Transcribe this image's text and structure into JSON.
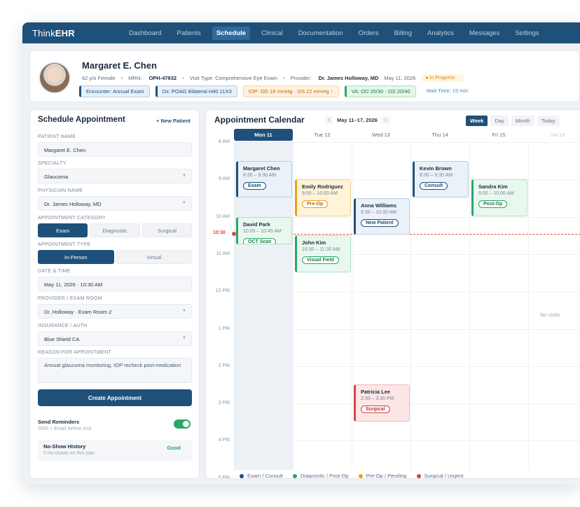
{
  "app": {
    "logo_prefix": "Think",
    "logo_suffix": "EHR",
    "nav": [
      "Dashboard",
      "Patients",
      "Schedule",
      "Clinical",
      "Documentation",
      "Orders",
      "Billing",
      "Analytics",
      "Messages",
      "Settings"
    ],
    "active_nav": "Schedule"
  },
  "patient": {
    "name": "Margaret E. Chen",
    "age_sex": "62 y/o Female",
    "mrn_label": "MRN:",
    "mrn": "OPH-47832",
    "visit_type": "Visit Type: Comprehensive Eye Exam",
    "provider_label": "Provider:",
    "provider": "Dr. James Holloway, MD",
    "date": "May 11, 2026",
    "status": "In Progress",
    "chips": {
      "encounter": "Encounter: Annual Exam",
      "dx": "Dx: POAG Bilateral H40.11X3",
      "iop": "IOP: OD 18 mmHg · OS 22 mmHg ↑",
      "va": "VA: OD 20/30 · OS 20/40",
      "wait": "Wait Time: 15 min"
    }
  },
  "form": {
    "title": "Schedule Appointment",
    "new_patient": "+ New Patient",
    "patient_name_label": "Patient Name",
    "patient_name": "Margaret E. Chen",
    "specialty_label": "Specialty",
    "specialty": "Glaucoma",
    "physician_label": "Physician Name",
    "physician": "Dr. James Holloway, MD",
    "category_label": "Appointment Category",
    "categories": [
      "Exam",
      "Diagnostic",
      "Surgical"
    ],
    "type_label": "Appointment Type",
    "types": [
      "In-Person",
      "Virtual"
    ],
    "datetime_label": "Date & Time",
    "datetime": "May 11, 2026 · 10:30 AM",
    "room_label": "Provider / Exam Room",
    "room": "Dr. Holloway · Exam Room 2",
    "insurance_label": "Insurance / Auth",
    "insurance": "Blue Shield CA",
    "reason_label": "Reason for Appointment",
    "reason": "Annual glaucoma monitoring, IOP recheck post-medication",
    "create_button": "Create Appointment",
    "reminders_label": "Send Reminders",
    "reminders_sub": "SMS + Email before visit",
    "reminders_on": true,
    "noshow_label": "No-Show History",
    "noshow_sub": "0 no-shows on this plan",
    "noshow_status": "Good"
  },
  "calendar": {
    "title": "Appointment Calendar",
    "range": "May 11–17, 2026",
    "views": [
      "Week",
      "Day",
      "Month",
      "Today"
    ],
    "days": [
      "Mon 11",
      "Tue 12",
      "Wed 13",
      "Thu 14",
      "Fri 15",
      "Sat 16"
    ],
    "hours": [
      "8 AM",
      "9 AM",
      "10 AM",
      "11 AM",
      "12 PM",
      "1 PM",
      "2 PM",
      "3 PM",
      "4 PM",
      "5 PM"
    ],
    "now_label": "10:30",
    "no_visits": "No visits",
    "appointments": [
      {
        "name": "Margaret Chen",
        "time": "8:30 – 9:30 AM",
        "tag": "Exam",
        "day": 0,
        "start": 8.5,
        "end": 9.5,
        "kind": "blue"
      },
      {
        "name": "David Park",
        "time": "10:00 – 10:45 AM",
        "tag": "OCT Scan",
        "day": 0,
        "start": 10.0,
        "end": 10.75,
        "kind": "green"
      },
      {
        "name": "Emily Rodriguez",
        "time": "9:00 – 10:00 AM",
        "tag": "Pre-Op",
        "day": 1,
        "start": 9.0,
        "end": 10.0,
        "kind": "orange"
      },
      {
        "name": "John Kim",
        "time": "10:30 – 11:30 AM",
        "tag": "Visual Field",
        "day": 1,
        "start": 10.5,
        "end": 11.5,
        "kind": "green"
      },
      {
        "name": "Anna Williams",
        "time": "9:30 – 10:30 AM",
        "tag": "New Patient",
        "day": 2,
        "start": 9.5,
        "end": 10.5,
        "kind": "blue"
      },
      {
        "name": "Patricia Lee",
        "time": "2:30 – 3:30 PM",
        "tag": "Surgical",
        "day": 2,
        "start": 14.5,
        "end": 15.5,
        "kind": "red"
      },
      {
        "name": "Kevin Brown",
        "time": "8:30 – 9:30 AM",
        "tag": "Consult",
        "day": 3,
        "start": 8.5,
        "end": 9.5,
        "kind": "blue"
      },
      {
        "name": "Sandra Kim",
        "time": "9:00 – 10:00 AM",
        "tag": "Post-Op",
        "day": 4,
        "start": 9.0,
        "end": 10.0,
        "kind": "green"
      }
    ],
    "legend": [
      {
        "label": "Exam / Consult",
        "color": "#1f5079"
      },
      {
        "label": "Diagnostic / Post-Op",
        "color": "#2ba66a"
      },
      {
        "label": "Pre-Op / Pending",
        "color": "#e7a11a"
      },
      {
        "label": "Surgical / Urgent",
        "color": "#d64545"
      }
    ]
  }
}
